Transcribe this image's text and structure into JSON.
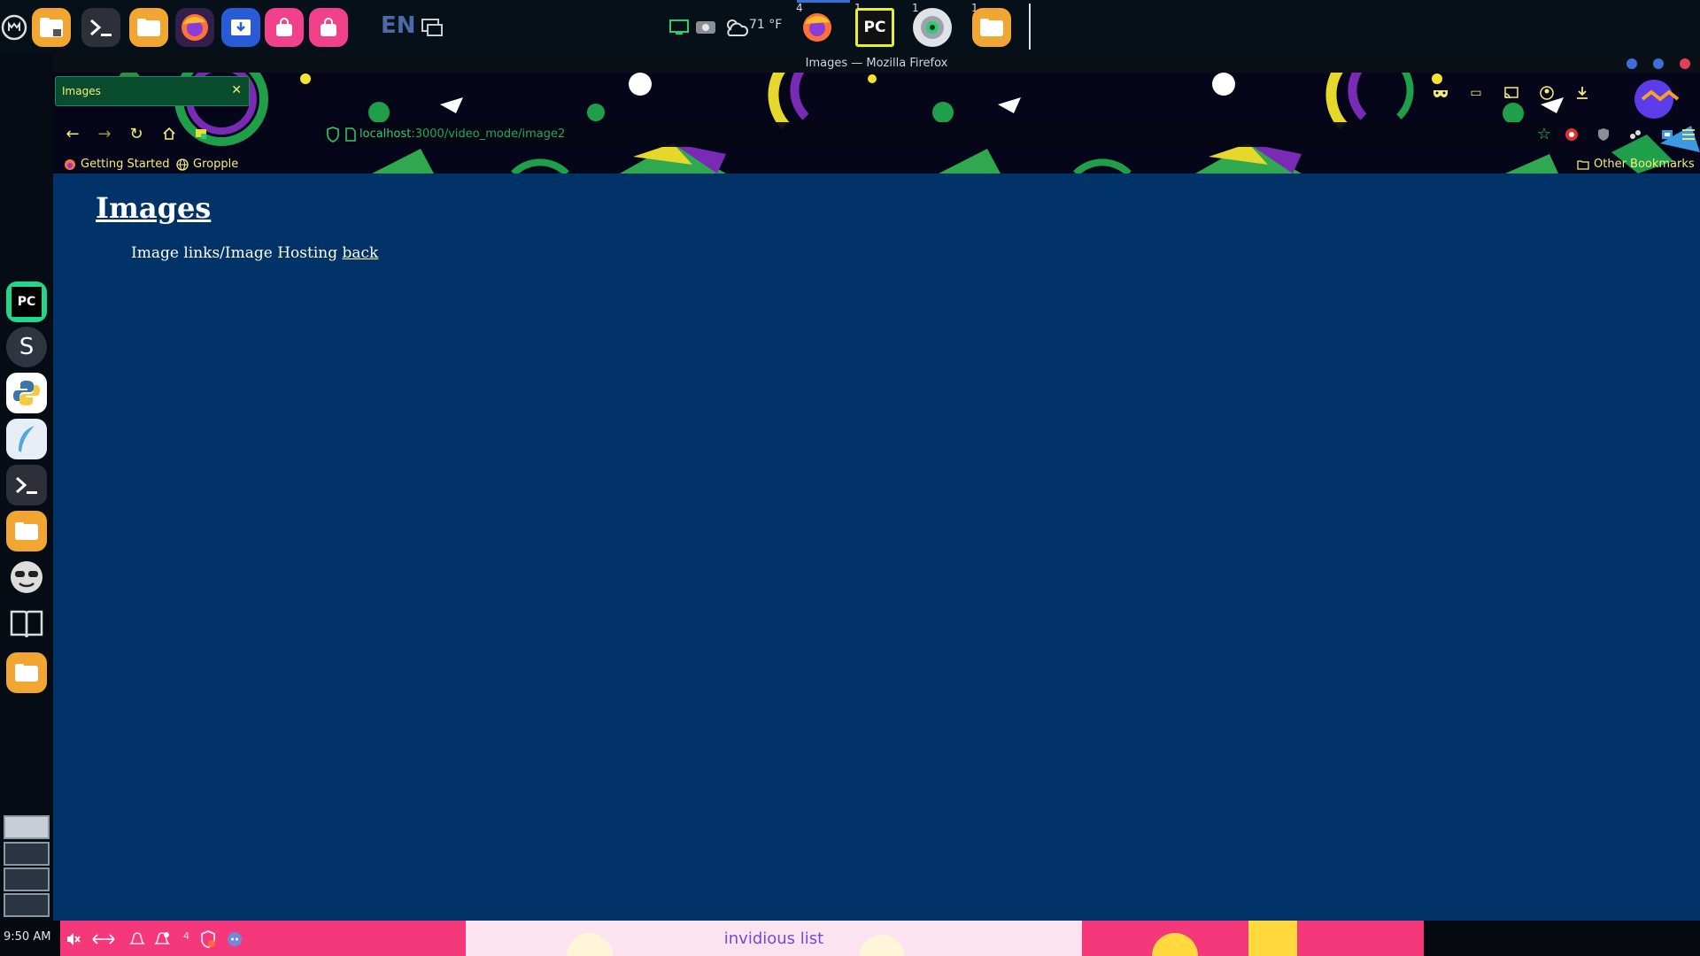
{
  "top_panel": {
    "language": "EN",
    "weather": "71 °F",
    "badges": {
      "firefox": "4",
      "pycharm": "1",
      "monitor": "1",
      "files": "1"
    }
  },
  "window": {
    "title": "Images — Mozilla Firefox"
  },
  "browser": {
    "tab_title": "Images",
    "url_host": "localhost",
    "url_path": ":3000/video_mode/image2",
    "bookmarks": [
      "Getting Started",
      "Gropple"
    ],
    "other_bookmarks": "Other Bookmarks"
  },
  "page": {
    "title": "Images",
    "text": "Image links/Image Hosting",
    "back_link": "back"
  },
  "bottom_panel": {
    "clock": "9:50 AM",
    "notification_count": "4",
    "taskbar_label": "invidious list"
  },
  "colors": {
    "page_background": "#013369",
    "theme_accent": "#f6ec7a",
    "url_green": "#2ecc71",
    "taskbar_pink": "#f4387a"
  }
}
